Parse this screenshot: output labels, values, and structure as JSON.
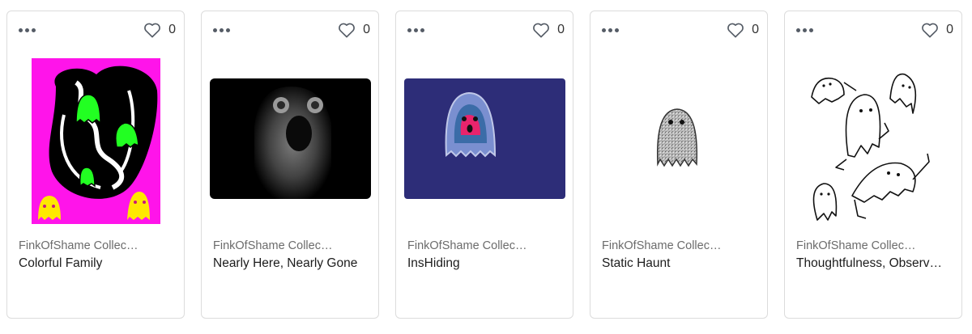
{
  "cards": [
    {
      "collection": "FinkOfShame Collecti…",
      "title": "Colorful Family",
      "likes": "0",
      "more_icon": "more-dots-icon",
      "like_icon": "heart-outline-icon"
    },
    {
      "collection": "FinkOfShame Collecti…",
      "title": "Nearly Here, Nearly Gone",
      "likes": "0",
      "more_icon": "more-dots-icon",
      "like_icon": "heart-outline-icon"
    },
    {
      "collection": "FinkOfShame Collecti…",
      "title": "InsHiding",
      "likes": "0",
      "more_icon": "more-dots-icon",
      "like_icon": "heart-outline-icon"
    },
    {
      "collection": "FinkOfShame Collecti…",
      "title": "Static Haunt",
      "likes": "0",
      "more_icon": "more-dots-icon",
      "like_icon": "heart-outline-icon"
    },
    {
      "collection": "FinkOfShame Collecti…",
      "title": "Thoughtfulness, Observ…",
      "likes": "0",
      "more_icon": "more-dots-icon",
      "like_icon": "heart-outline-icon"
    }
  ],
  "colors": {
    "border": "#dcdcdc",
    "icon": "#555c66",
    "muted_text": "#6b6b6b"
  }
}
